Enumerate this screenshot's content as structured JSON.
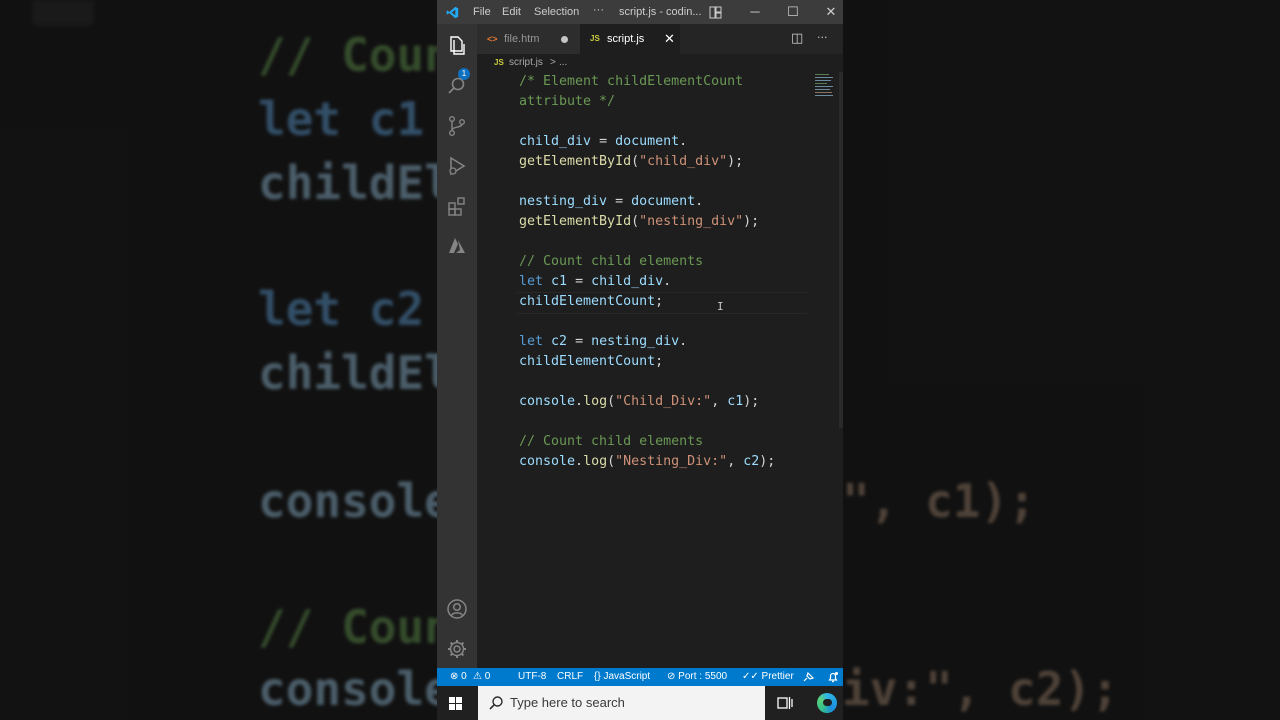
{
  "background": {
    "lines": [
      {
        "text": "// Coun",
        "cls": "c"
      },
      {
        "text": "let c1 ",
        "cls": "k"
      },
      {
        "text": "childEl",
        "cls": "v"
      },
      {
        "text": "let c2 ",
        "cls": "k"
      },
      {
        "text": "childEl",
        "cls": "v"
      },
      {
        "text": "console",
        "cls": "v"
      },
      {
        "text": "\", c1);",
        "cls": "s"
      },
      {
        "text": "// Coun",
        "cls": "c"
      },
      {
        "text": "console",
        "cls": "v"
      },
      {
        "text": "iv:\", c2);",
        "cls": "s"
      }
    ]
  },
  "titlebar": {
    "menu_file": "File",
    "menu_edit": "Edit",
    "menu_selection": "Selection",
    "menu_more": "···",
    "title": "script.js - codin...",
    "minimize": "─",
    "maximize": "☐",
    "close": "✕"
  },
  "activity_bar": {
    "explorer_badge": "1",
    "icons": [
      "explorer-icon",
      "search-icon",
      "source-control-icon",
      "run-debug-icon",
      "extensions-icon",
      "azure-icon",
      "account-icon",
      "settings-gear-icon"
    ]
  },
  "tabs": [
    {
      "icon": "<>",
      "label": "file.htm",
      "modified": true
    },
    {
      "icon": "JS",
      "label": "script.js",
      "active": true,
      "close": "✕"
    }
  ],
  "tab_actions": {
    "split": "◫",
    "more": "···"
  },
  "breadcrumb": {
    "icon": "JS",
    "file": "script.js",
    "separator": ">",
    "rest": "..."
  },
  "code_lines": [
    [
      {
        "t": "/* Element childElementCount",
        "c": "c"
      }
    ],
    [
      {
        "t": "attribute */",
        "c": "c"
      }
    ],
    [],
    [
      {
        "t": "child_div",
        "c": "v"
      },
      {
        "t": " = ",
        "c": "p"
      },
      {
        "t": "document",
        "c": "v"
      },
      {
        "t": ".",
        "c": "p"
      }
    ],
    [
      {
        "t": "getElementById",
        "c": "f"
      },
      {
        "t": "(",
        "c": "p"
      },
      {
        "t": "\"child_div\"",
        "c": "s"
      },
      {
        "t": ");",
        "c": "p"
      }
    ],
    [],
    [
      {
        "t": "nesting_div",
        "c": "v"
      },
      {
        "t": " = ",
        "c": "p"
      },
      {
        "t": "document",
        "c": "v"
      },
      {
        "t": ".",
        "c": "p"
      }
    ],
    [
      {
        "t": "getElementById",
        "c": "f"
      },
      {
        "t": "(",
        "c": "p"
      },
      {
        "t": "\"nesting_div\"",
        "c": "s"
      },
      {
        "t": ");",
        "c": "p"
      }
    ],
    [],
    [
      {
        "t": "// Count child elements",
        "c": "c"
      }
    ],
    [
      {
        "t": "let",
        "c": "k"
      },
      {
        "t": " ",
        "c": "p"
      },
      {
        "t": "c1",
        "c": "v"
      },
      {
        "t": " = ",
        "c": "p"
      },
      {
        "t": "child_div",
        "c": "v"
      },
      {
        "t": ".",
        "c": "p"
      }
    ],
    [
      {
        "t": "childElementCount",
        "c": "v"
      },
      {
        "t": ";",
        "c": "p"
      }
    ],
    [],
    [
      {
        "t": "let",
        "c": "k"
      },
      {
        "t": " ",
        "c": "p"
      },
      {
        "t": "c2",
        "c": "v"
      },
      {
        "t": " = ",
        "c": "p"
      },
      {
        "t": "nesting_div",
        "c": "v"
      },
      {
        "t": ".",
        "c": "p"
      }
    ],
    [
      {
        "t": "childElementCount",
        "c": "v"
      },
      {
        "t": ";",
        "c": "p"
      }
    ],
    [],
    [
      {
        "t": "console",
        "c": "v"
      },
      {
        "t": ".",
        "c": "p"
      },
      {
        "t": "log",
        "c": "f"
      },
      {
        "t": "(",
        "c": "p"
      },
      {
        "t": "\"Child_Div:\"",
        "c": "s"
      },
      {
        "t": ", ",
        "c": "p"
      },
      {
        "t": "c1",
        "c": "v"
      },
      {
        "t": ");",
        "c": "p"
      }
    ],
    [],
    [
      {
        "t": "// Count child elements",
        "c": "c"
      }
    ],
    [
      {
        "t": "console",
        "c": "v"
      },
      {
        "t": ".",
        "c": "p"
      },
      {
        "t": "log",
        "c": "f"
      },
      {
        "t": "(",
        "c": "p"
      },
      {
        "t": "\"Nesting_Div:\"",
        "c": "s"
      },
      {
        "t": ", ",
        "c": "p"
      },
      {
        "t": "c2",
        "c": "v"
      },
      {
        "t": ");",
        "c": "p"
      }
    ]
  ],
  "statusbar": {
    "errors": "⊗ 0",
    "warnings": "⚠ 0",
    "encoding": "UTF-8",
    "eol": "CRLF",
    "language": "{} JavaScript",
    "port": "⊘ Port : 5500",
    "prettier": "✓✓ Prettier",
    "feedback_icon": "feedback-icon",
    "bell_icon": "notifications-bell-icon"
  },
  "taskbar": {
    "search_placeholder": "Type here to search"
  },
  "colors": {
    "editor_bg": "#1e1e1e",
    "statusbar_bg": "#007acc",
    "activity_bg": "#333333",
    "comment": "#6a9955",
    "keyword": "#569cd6",
    "variable": "#9cdcfe",
    "function": "#dcdcaa",
    "string": "#ce9178"
  }
}
